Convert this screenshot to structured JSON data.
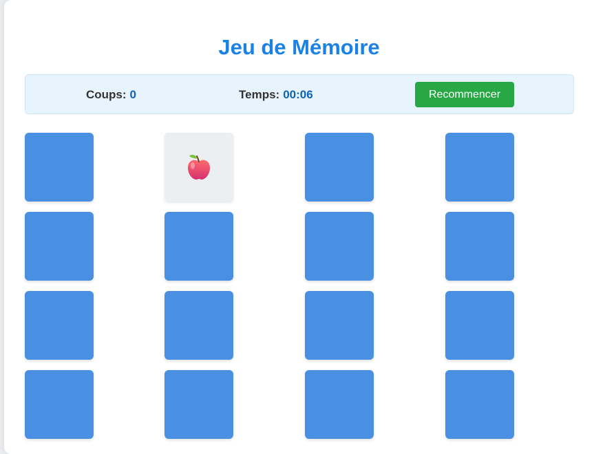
{
  "app": {
    "title": "Jeu de Mémoire"
  },
  "stats": {
    "moves_label": "Coups:",
    "moves_value": "0",
    "time_label": "Temps:",
    "time_value": "00:06"
  },
  "controls": {
    "restart_label": "Recommencer"
  },
  "board": {
    "columns": 4,
    "rows_visible": 4,
    "cards": [
      {
        "state": "hidden"
      },
      {
        "state": "revealed",
        "face": "apple"
      },
      {
        "state": "hidden"
      },
      {
        "state": "hidden"
      },
      {
        "state": "hidden"
      },
      {
        "state": "hidden"
      },
      {
        "state": "hidden"
      },
      {
        "state": "hidden"
      },
      {
        "state": "hidden"
      },
      {
        "state": "hidden"
      },
      {
        "state": "hidden"
      },
      {
        "state": "hidden"
      },
      {
        "state": "hidden"
      },
      {
        "state": "hidden"
      },
      {
        "state": "hidden"
      },
      {
        "state": "hidden"
      }
    ]
  },
  "colors": {
    "title": "#1a82e6",
    "accent_value": "#0d62b8",
    "stats_background": "#e8f4fd",
    "card_back": "#4a90e2",
    "card_face": "#eceff1",
    "restart_button": "#28a745"
  },
  "icons": {
    "apple": "apple-icon"
  }
}
